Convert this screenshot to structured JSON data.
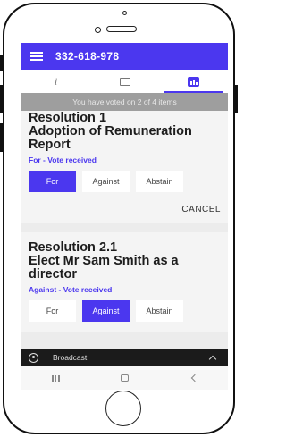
{
  "header": {
    "title": "332-618-978"
  },
  "tabs": [
    {
      "icon": "info-icon",
      "glyph": "i",
      "active": false
    },
    {
      "icon": "chat-icon",
      "active": false
    },
    {
      "icon": "chart-icon",
      "active": true
    }
  ],
  "status_banner": "You have voted on 2 of 4 items",
  "resolutions": [
    {
      "title": "Resolution 1\nAdoption of Remuneration Report",
      "status": "For - Vote received",
      "choices": [
        "For",
        "Against",
        "Abstain"
      ],
      "selected": "For",
      "cancel_label": "CANCEL"
    },
    {
      "title": "Resolution 2.1\nElect Mr Sam Smith as a director",
      "status": "Against - Vote received",
      "choices": [
        "For",
        "Against",
        "Abstain"
      ],
      "selected": "Against"
    }
  ],
  "broadcast": {
    "label": "Broadcast",
    "icon": "broadcast-icon"
  },
  "colors": {
    "accent": "#4b37ef",
    "banner": "#9e9e9e",
    "broadcast_bar": "#1b1b1b"
  }
}
